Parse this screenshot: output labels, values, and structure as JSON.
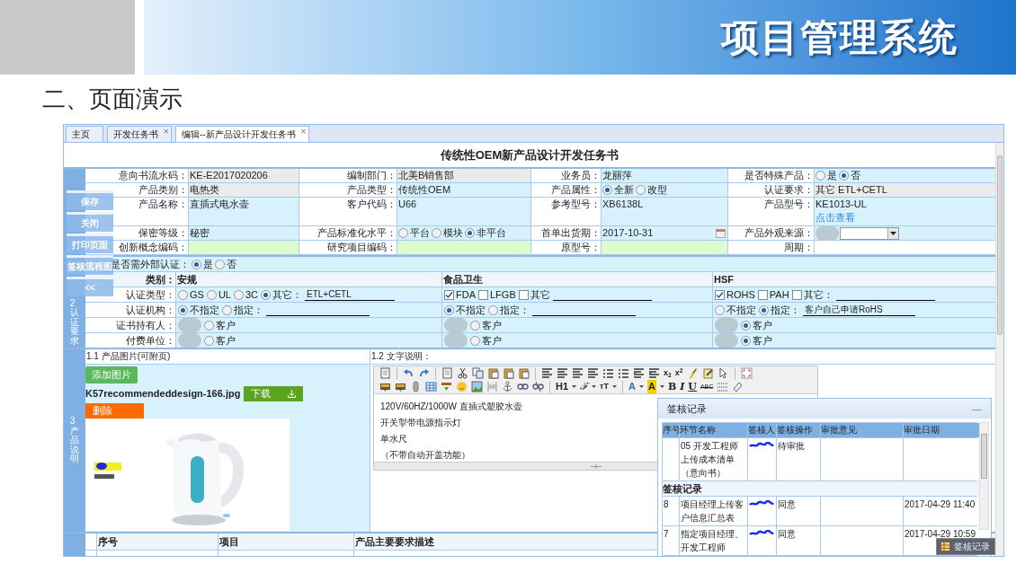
{
  "slide": {
    "banner_title": "项目管理系统",
    "heading": "二、页面演示"
  },
  "tabs": [
    {
      "label": "主页",
      "selected": false
    },
    {
      "label": "开发任务书",
      "selected": false,
      "close": "×"
    },
    {
      "label": "编辑--新产品设计开发任务书",
      "selected": true,
      "close": "×"
    }
  ],
  "form_title": "传统性OEM新产品设计开发任务书",
  "side_buttons": [
    "保存",
    "关闭",
    "打印页面",
    "签核流程图",
    "<<"
  ],
  "basic_info": {
    "rows": [
      {
        "fields": [
          {
            "label": "意向书流水码：",
            "kind": "text",
            "readonly": true,
            "value": "KE-E2017020206"
          },
          {
            "label": "编制部门：",
            "kind": "text",
            "readonly": true,
            "value": "北美B销售部"
          },
          {
            "label": "业务员：",
            "kind": "text",
            "readonly": false,
            "value": "龙丽萍"
          },
          {
            "label": "是否特殊产品：",
            "kind": "radio",
            "readonly": false,
            "options": [
              {
                "label": "是",
                "selected": false
              },
              {
                "label": "否",
                "selected": true
              }
            ]
          }
        ]
      },
      {
        "fields": [
          {
            "label": "产品类别：",
            "kind": "text",
            "readonly": true,
            "value": "电热类"
          },
          {
            "label": "产品类型：",
            "kind": "text",
            "readonly": false,
            "value": "传统性OEM"
          },
          {
            "label": "产品属性：",
            "kind": "radio",
            "readonly": false,
            "options": [
              {
                "label": "全新",
                "selected": true
              },
              {
                "label": "改型",
                "selected": false
              }
            ]
          },
          {
            "label": "认证要求：",
            "kind": "text",
            "readonly": true,
            "value": "其它 ETL+CETL"
          }
        ]
      },
      {
        "fields": [
          {
            "label": "产品名称：",
            "kind": "text",
            "readonly": false,
            "value": "直插式电水壶"
          },
          {
            "label": "客户代码：",
            "kind": "text",
            "readonly": false,
            "value": "U66"
          },
          {
            "label": "参考型号：",
            "kind": "text",
            "readonly": false,
            "value": "XB6138L"
          },
          {
            "label": "产品型号：",
            "kind": "text",
            "readonly": false,
            "value": "KE1013-UL",
            "link": "点击查看"
          }
        ]
      },
      {
        "fields": [
          {
            "label": "保密等级：",
            "kind": "text",
            "readonly": false,
            "value": "秘密"
          },
          {
            "label": "产品标准化水平：",
            "kind": "radio",
            "readonly": false,
            "options": [
              {
                "label": "平台",
                "selected": false
              },
              {
                "label": "模块",
                "selected": false
              },
              {
                "label": "非平台",
                "selected": true
              }
            ]
          },
          {
            "label": "首单出货期：",
            "kind": "date",
            "readonly": false,
            "value": "2017-10-31"
          },
          {
            "label": "产品外观来源：",
            "kind": "select",
            "readonly": false
          }
        ]
      },
      {
        "fields": [
          {
            "label": "创新概念编码：",
            "kind": "text",
            "required": true
          },
          {
            "label": "研究项目编码：",
            "kind": "text",
            "required": true
          },
          {
            "label": "原型号：",
            "kind": "text",
            "required": true
          },
          {
            "label": "周期：",
            "kind": "static"
          }
        ]
      }
    ]
  },
  "certification": {
    "section_label": "2认证要求",
    "external": {
      "label": "是否需外部认证：",
      "options": [
        {
          "label": "是",
          "selected": true
        },
        {
          "label": "否",
          "selected": false
        }
      ]
    },
    "category_label": "类别：",
    "row_labels": [
      "认证类型：",
      "认证机构：",
      "证书持有人：",
      "付费单位："
    ],
    "groups": [
      {
        "name": "安规",
        "rows": [
          {
            "options": [
              {
                "kind": "radio",
                "label": "GS",
                "selected": false
              },
              {
                "kind": "radio",
                "label": "UL",
                "selected": false
              },
              {
                "kind": "radio",
                "label": "3C",
                "selected": false
              },
              {
                "kind": "radio",
                "label": "其它：",
                "selected": true,
                "fill_line": true,
                "fill": "ETL+CETL"
              }
            ]
          },
          {
            "options": [
              {
                "kind": "radio",
                "label": "不指定",
                "selected": true
              },
              {
                "kind": "radio",
                "label": "指定：",
                "selected": false,
                "fill_line": true
              }
            ]
          },
          {
            "options": [
              {
                "kind": "blur"
              },
              {
                "kind": "radio",
                "label": "客户",
                "selected": false
              }
            ]
          },
          {
            "options": [
              {
                "kind": "blur"
              },
              {
                "kind": "radio",
                "label": "客户",
                "selected": false
              }
            ]
          }
        ]
      },
      {
        "name": "食品卫生",
        "rows": [
          {
            "options": [
              {
                "kind": "check",
                "label": "FDA",
                "selected": true
              },
              {
                "kind": "check",
                "label": "LFGB",
                "selected": false
              },
              {
                "kind": "check",
                "label": "其它",
                "selected": false,
                "fill_line": true
              }
            ]
          },
          {
            "options": [
              {
                "kind": "radio",
                "label": "不指定",
                "selected": true
              },
              {
                "kind": "radio",
                "label": "指定：",
                "selected": false,
                "fill_line": true
              }
            ]
          },
          {
            "options": [
              {
                "kind": "blur"
              },
              {
                "kind": "radio",
                "label": "客户",
                "selected": false
              }
            ]
          },
          {
            "options": [
              {
                "kind": "blur"
              },
              {
                "kind": "radio",
                "label": "客户",
                "selected": false
              }
            ]
          }
        ]
      },
      {
        "name": "HSF",
        "rows": [
          {
            "options": [
              {
                "kind": "check",
                "label": "ROHS",
                "selected": true
              },
              {
                "kind": "check",
                "label": "PAH",
                "selected": false
              },
              {
                "kind": "check",
                "label": "其它：",
                "selected": false,
                "fill_line": true
              }
            ]
          },
          {
            "options": [
              {
                "kind": "radio",
                "label": "不指定",
                "selected": false
              },
              {
                "kind": "radio",
                "label": "指定：",
                "selected": true,
                "fill_line": true,
                "fill": "客户自己申请RoHS"
              }
            ]
          },
          {
            "options": [
              {
                "kind": "blur"
              },
              {
                "kind": "radio",
                "label": "客户",
                "selected": true
              }
            ]
          },
          {
            "options": [
              {
                "kind": "blur"
              },
              {
                "kind": "radio",
                "label": "客户",
                "selected": true
              }
            ]
          }
        ]
      }
    ]
  },
  "product": {
    "section_label": "3产品说明",
    "image_header": "1.1 产品图片(可附页)",
    "text_header": "1.2 文字说明：",
    "add_button": "添加图片",
    "file_name": "K57recommendeddesign-166.jpg",
    "download_button": "下载",
    "delete_button": "删除",
    "toolbar": {
      "row1": [
        "x$_{2}$",
        "x$^{2}$"
      ],
      "row2": [
        "H1",
        "ℱ",
        "тT",
        "A",
        "A",
        "B",
        "I",
        "U",
        "ABC"
      ]
    },
    "text_lines": [
      "120V/60HZ/1000W 直插式塑胶水壶",
      "开关掣带电源指示灯",
      "单水尺",
      "（不带自动开盖功能）"
    ]
  },
  "requirements": {
    "columns": [
      "序号",
      "项目",
      "产品主要要求描述"
    ]
  },
  "review": {
    "title": "签核记录",
    "minimize": "—",
    "columns": [
      "序号",
      "环节名称",
      "签核人",
      "签核操作",
      "审批意见",
      "审批日期"
    ],
    "pending": [
      {
        "step": "05 开发工程师上传成本清单（意向书）",
        "signer_redacted": true,
        "action": "待审批"
      }
    ],
    "group_label": "签核记录",
    "records": [
      {
        "no": "8",
        "step": "项目经理上传客户信息汇总表",
        "signer_redacted": true,
        "action": "同意",
        "date": "2017-04-29 11:40"
      },
      {
        "no": "7",
        "step": "指定项目经理、开发工程师",
        "signer_redacted": true,
        "action": "同意",
        "date": "2017-04-29 10:59"
      }
    ]
  },
  "review_button": "签核记录"
}
